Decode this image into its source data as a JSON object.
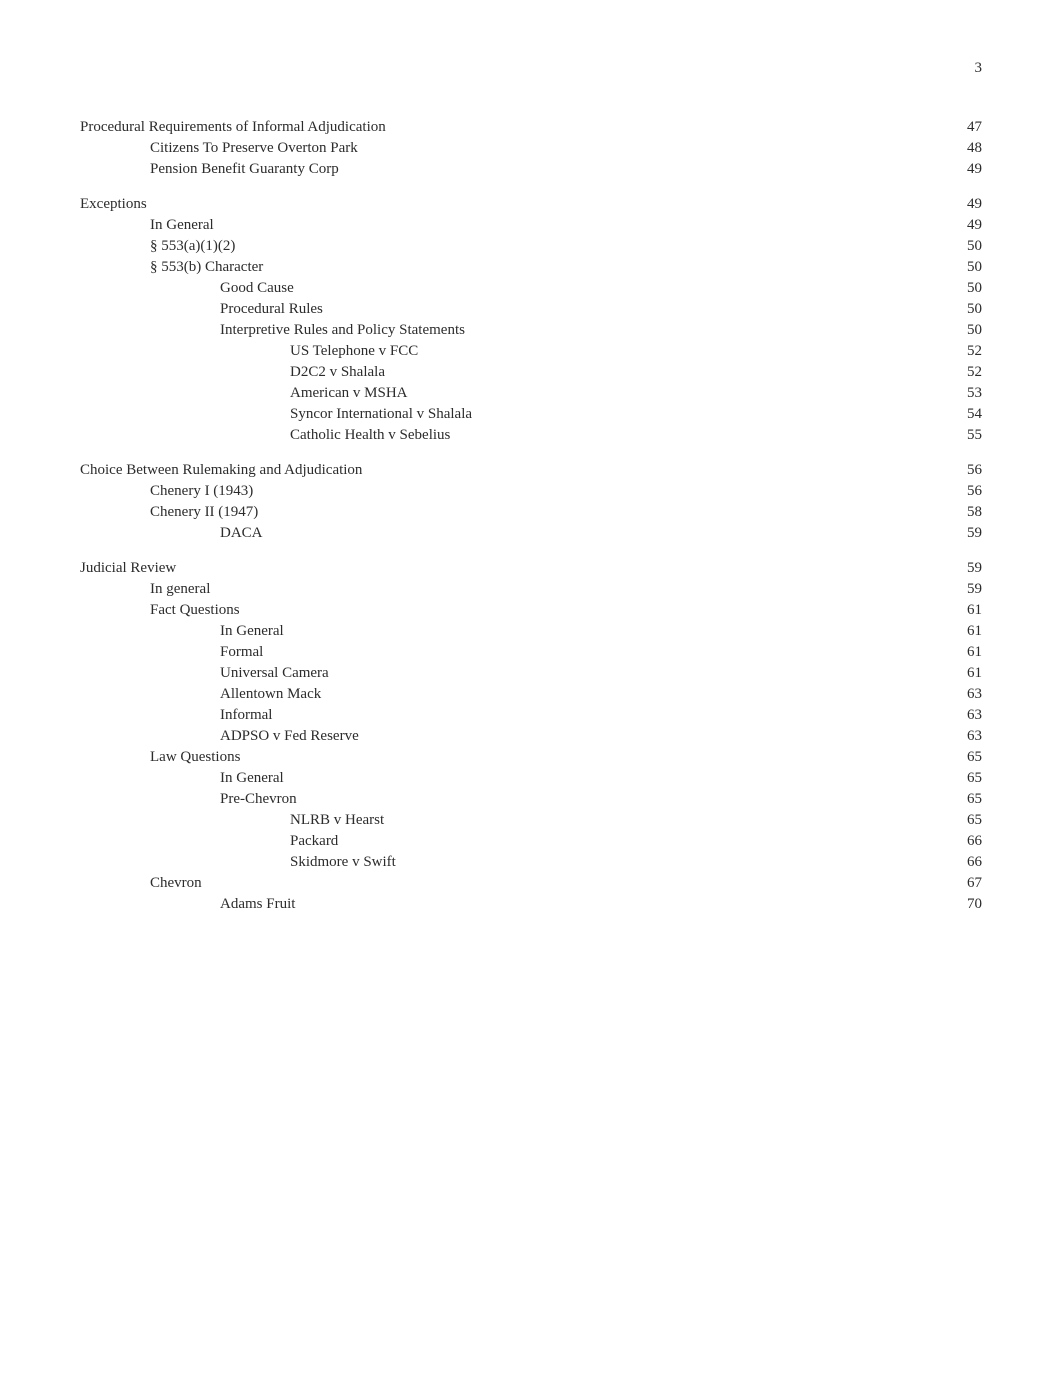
{
  "page": {
    "number": "3",
    "entries": [
      {
        "id": "procedural-requirements",
        "label": "Procedural Requirements of Informal Adjudication",
        "page": "47",
        "indent": 0,
        "spacer_before": false
      },
      {
        "id": "citizens-preserve",
        "label": "Citizens To Preserve Overton Park",
        "page": "48",
        "indent": 1,
        "spacer_before": false
      },
      {
        "id": "pension-benefit",
        "label": "Pension Benefit Guaranty Corp",
        "page": "49",
        "indent": 1,
        "spacer_before": false
      },
      {
        "id": "spacer-1",
        "spacer": true
      },
      {
        "id": "exceptions",
        "label": "Exceptions",
        "page": "49",
        "indent": 0,
        "spacer_before": false
      },
      {
        "id": "in-general-exceptions",
        "label": "In General",
        "page": "49",
        "indent": 1,
        "spacer_before": false
      },
      {
        "id": "553a12",
        "label": "§ 553(a)(1)(2)",
        "page": "50",
        "indent": 1,
        "spacer_before": false
      },
      {
        "id": "553b-character",
        "label": "§ 553(b) Character",
        "page": "50",
        "indent": 1,
        "spacer_before": false
      },
      {
        "id": "good-cause",
        "label": "Good Cause",
        "page": "50",
        "indent": 2,
        "spacer_before": false
      },
      {
        "id": "procedural-rules",
        "label": "Procedural Rules",
        "page": "50",
        "indent": 2,
        "spacer_before": false
      },
      {
        "id": "interpretive-rules",
        "label": "Interpretive Rules and Policy Statements",
        "page": "50",
        "indent": 2,
        "spacer_before": false
      },
      {
        "id": "us-telephone",
        "label": "US Telephone v FCC",
        "page": "52",
        "indent": 3,
        "spacer_before": false
      },
      {
        "id": "d2c2-shalala",
        "label": "D2C2 v Shalala",
        "page": "52",
        "indent": 3,
        "spacer_before": false
      },
      {
        "id": "american-msha",
        "label": "American v MSHA",
        "page": "53",
        "indent": 3,
        "spacer_before": false
      },
      {
        "id": "syncor-shalala",
        "label": "Syncor International v Shalala",
        "page": "54",
        "indent": 3,
        "spacer_before": false
      },
      {
        "id": "catholic-health",
        "label": "Catholic Health v Sebelius",
        "page": "55",
        "indent": 3,
        "spacer_before": false
      },
      {
        "id": "spacer-2",
        "spacer": true
      },
      {
        "id": "choice-between",
        "label": "Choice Between Rulemaking and Adjudication",
        "page": "56",
        "indent": 0,
        "spacer_before": false
      },
      {
        "id": "chenery-i",
        "label": "Chenery I (1943)",
        "page": "56",
        "indent": 1,
        "spacer_before": false
      },
      {
        "id": "chenery-ii",
        "label": "Chenery II (1947)",
        "page": "58",
        "indent": 1,
        "spacer_before": false
      },
      {
        "id": "daca",
        "label": "DACA",
        "page": "59",
        "indent": 2,
        "spacer_before": false
      },
      {
        "id": "spacer-3",
        "spacer": true
      },
      {
        "id": "judicial-review",
        "label": "Judicial Review",
        "page": "59",
        "indent": 0,
        "spacer_before": false
      },
      {
        "id": "in-general-judicial",
        "label": "In general",
        "page": "59",
        "indent": 1,
        "spacer_before": false
      },
      {
        "id": "fact-questions",
        "label": "Fact Questions",
        "page": "61",
        "indent": 1,
        "spacer_before": false
      },
      {
        "id": "in-general-fact",
        "label": "In General",
        "page": "61",
        "indent": 2,
        "spacer_before": false
      },
      {
        "id": "formal",
        "label": "Formal",
        "page": "61",
        "indent": 2,
        "spacer_before": false
      },
      {
        "id": "universal-camera",
        "label": "Universal Camera",
        "page": "61",
        "indent": 2,
        "spacer_before": false
      },
      {
        "id": "allentown-mack",
        "label": "Allentown Mack",
        "page": "63",
        "indent": 2,
        "spacer_before": false
      },
      {
        "id": "informal",
        "label": "Informal",
        "page": "63",
        "indent": 2,
        "spacer_before": false
      },
      {
        "id": "adpso-fed-reserve",
        "label": "ADPSO v Fed Reserve",
        "page": "63",
        "indent": 2,
        "spacer_before": false
      },
      {
        "id": "law-questions",
        "label": "Law Questions",
        "page": "65",
        "indent": 1,
        "spacer_before": false
      },
      {
        "id": "in-general-law",
        "label": "In General",
        "page": "65",
        "indent": 2,
        "spacer_before": false
      },
      {
        "id": "pre-chevron",
        "label": "Pre-Chevron",
        "page": "65",
        "indent": 2,
        "spacer_before": false
      },
      {
        "id": "nlrb-hearst",
        "label": "NLRB v Hearst",
        "page": "65",
        "indent": 3,
        "spacer_before": false
      },
      {
        "id": "packard",
        "label": "Packard",
        "page": "66",
        "indent": 3,
        "spacer_before": false
      },
      {
        "id": "skidmore-swift",
        "label": "Skidmore v Swift",
        "page": "66",
        "indent": 3,
        "spacer_before": false
      },
      {
        "id": "chevron",
        "label": "Chevron",
        "page": "67",
        "indent": 1,
        "spacer_before": false
      },
      {
        "id": "adams-fruit",
        "label": "Adams Fruit",
        "page": "70",
        "indent": 2,
        "spacer_before": false
      }
    ]
  }
}
